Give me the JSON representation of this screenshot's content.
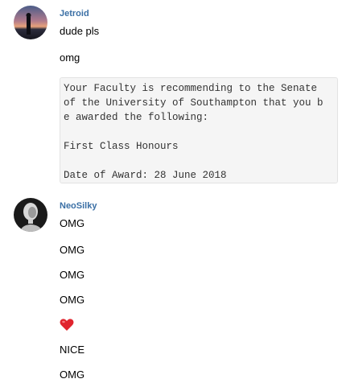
{
  "messages": [
    {
      "username": "Jetroid",
      "avatar_icon": "sunset-silhouette-avatar",
      "lines": [
        "dude pls",
        "omg"
      ],
      "code_block": [
        "Your Faculty is recommending to the Senate",
        "of the University of Southampton that you b",
        "e awarded the following:",
        "",
        "First Class Honours",
        "",
        "Date of Award: 28 June 2018"
      ]
    },
    {
      "username": "NeoSilky",
      "avatar_icon": "monochrome-portrait-avatar",
      "lines": [
        "OMG",
        "OMG",
        "OMG",
        "OMG",
        "NICE",
        "OMG"
      ],
      "emoji": "heart-emoji"
    }
  ],
  "colors": {
    "username": "#3a6fa5",
    "code_background": "#f5f5f5",
    "heart": "#e0242e"
  }
}
